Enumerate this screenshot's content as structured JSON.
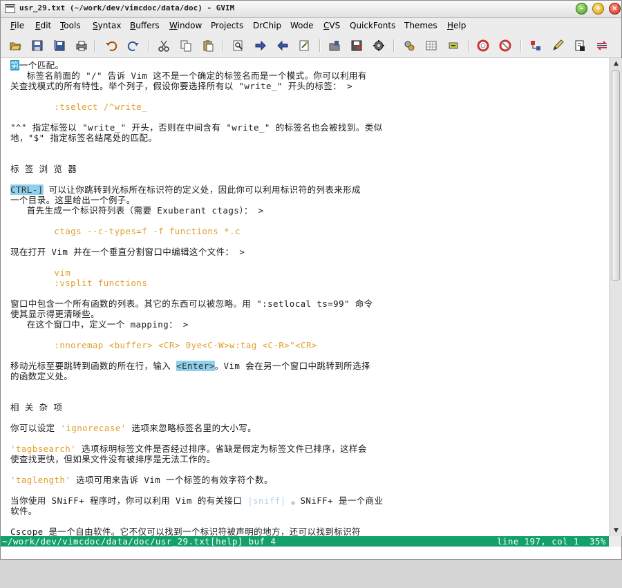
{
  "window": {
    "title": "usr_29.txt (~/work/dev/vimcdoc/data/doc) - GVIM"
  },
  "menu": {
    "items": [
      {
        "label": "File",
        "u": "F",
        "rest": "ile"
      },
      {
        "label": "Edit",
        "u": "E",
        "rest": "dit"
      },
      {
        "label": "Tools",
        "u": "T",
        "rest": "ools"
      },
      {
        "label": "Syntax",
        "u": "S",
        "rest": "yntax"
      },
      {
        "label": "Buffers",
        "u": "B",
        "rest": "uffers"
      },
      {
        "label": "Window",
        "u": "W",
        "rest": "indow"
      },
      {
        "label": "Projects",
        "u": "",
        "rest": "Projects"
      },
      {
        "label": "DrChip",
        "u": "",
        "rest": "DrChip"
      },
      {
        "label": "Wode",
        "u": "",
        "rest": "Wode"
      },
      {
        "label": "CVS",
        "u": "C",
        "rest": "VS"
      },
      {
        "label": "QuickFonts",
        "u": "",
        "rest": "QuickFonts"
      },
      {
        "label": "Themes",
        "u": "",
        "rest": "Themes"
      },
      {
        "label": "Help",
        "u": "H",
        "rest": "elp"
      }
    ]
  },
  "toolbar": {
    "icons": [
      "open-icon",
      "save-icon",
      "save-all-icon",
      "print-icon",
      "undo-icon",
      "redo-icon",
      "cut-icon",
      "copy-icon",
      "paste-icon",
      "find-icon",
      "find-next-icon",
      "find-prev-icon",
      "replace-icon",
      "load-session-icon",
      "save-session-icon",
      "run-script-icon",
      "make-icon",
      "shell-icon",
      "ctags-icon",
      "jump-tag-icon",
      "lifebuoy-help-icon",
      "find-help-icon",
      "diff-icon",
      "edit-icon",
      "tag-icon",
      "swap-icon"
    ]
  },
  "editor": {
    "lines": [
      {
        "pre": "",
        "cur": "第",
        "post": "一个匹配。"
      },
      {
        "text": "   标签名前面的 \"/\" 告诉 Vim 这不是一个确定的标签名而是一个模式。你可以利用有"
      },
      {
        "text": "关查找模式的所有特性。举个列子，假设你要选择所有以 \"write_\" 开头的标签： >"
      },
      {
        "text": ""
      },
      {
        "ex": "        :tselect /^write_"
      },
      {
        "text": ""
      },
      {
        "text": "\"^\" 指定标签以 \"write_\" 开头，否则在中间含有 \"write_\" 的标签名也会被找到。类似"
      },
      {
        "text": "地，\"$\" 指定标签名结尾处的匹配。"
      },
      {
        "text": ""
      },
      {
        "text": ""
      },
      {
        "text": "标 签 浏 览 器"
      },
      {
        "text": ""
      },
      {
        "hl": "CTRL-]",
        "post": " 可以让你跳转到光标所在标识符的定义处，因此你可以利用标识符的列表来形成"
      },
      {
        "text": "一个目录。这里给出一个例子。"
      },
      {
        "text": "   首先生成一个标识符列表（需要 Exuberant ctags）： >"
      },
      {
        "text": ""
      },
      {
        "ex": "        ctags --c-types=f -f functions *.c"
      },
      {
        "text": ""
      },
      {
        "text": "现在打开 Vim 并在一个垂直分割窗口中编辑这个文件： >"
      },
      {
        "text": ""
      },
      {
        "ex": "        vim"
      },
      {
        "ex": "        :vsplit functions"
      },
      {
        "text": ""
      },
      {
        "text": "窗口中包含一个所有函数的列表。其它的东西可以被忽略。用 \":setlocal ts=99\" 命令"
      },
      {
        "text": "使其显示得更清晰些。"
      },
      {
        "text": "   在这个窗口中，定义一个 mapping： >"
      },
      {
        "text": ""
      },
      {
        "ex": "        :nnoremap <buffer> <CR> 0ye<C-W>w:tag <C-R>\"<CR>"
      },
      {
        "text": ""
      },
      {
        "pre": "移动光标至要跳转到函数的所在行，输入 ",
        "hl": "<Enter>",
        "post": "。Vim 会在另一个窗口中跳转到所选择"
      },
      {
        "text": "的函数定义处。"
      },
      {
        "text": ""
      },
      {
        "text": ""
      },
      {
        "text": "相 关 杂 项"
      },
      {
        "text": ""
      },
      {
        "pre": "你可以设定 ",
        "opt": "'ignorecase'",
        "post": " 选项来忽略标签名里的大小写。"
      },
      {
        "text": ""
      },
      {
        "opt": "'tagbsearch'",
        "post": " 选项标明标签文件是否经过排序。省缺是假定为标签文件已排序，这样会"
      },
      {
        "text": "使查找更快，但如果文件没有被排序是无法工作的。"
      },
      {
        "text": ""
      },
      {
        "opt": "'taglength'",
        "post": " 选项可用来告诉 Vim 一个标签的有效字符个数。"
      },
      {
        "text": ""
      },
      {
        "pre": "当你使用 SNiFF+ 程序时，你可以利用 Vim 的有关接口 ",
        "tag": "|sniff|",
        "post": " 。SNiFF+ 是一个商业"
      },
      {
        "text": "软件。"
      },
      {
        "text": ""
      },
      {
        "text": "Cscope 是一个自由软件。它不仅可以找到一个标识符被声明的地方，还可以找到标识符"
      }
    ]
  },
  "statusline": {
    "file": "~/work/dev/vimcdoc/data/doc/usr_29.txt[help] buf 4",
    "position": "line 197, col 1",
    "percent": "35%"
  },
  "scrollbar": {
    "position_fraction": 0.35
  },
  "colors": {
    "status_bg": "#13a06a",
    "example_fg": "#e0a02a",
    "highlight_bg": "#8fd0ea",
    "cursor_bg": "#26a0c8"
  }
}
